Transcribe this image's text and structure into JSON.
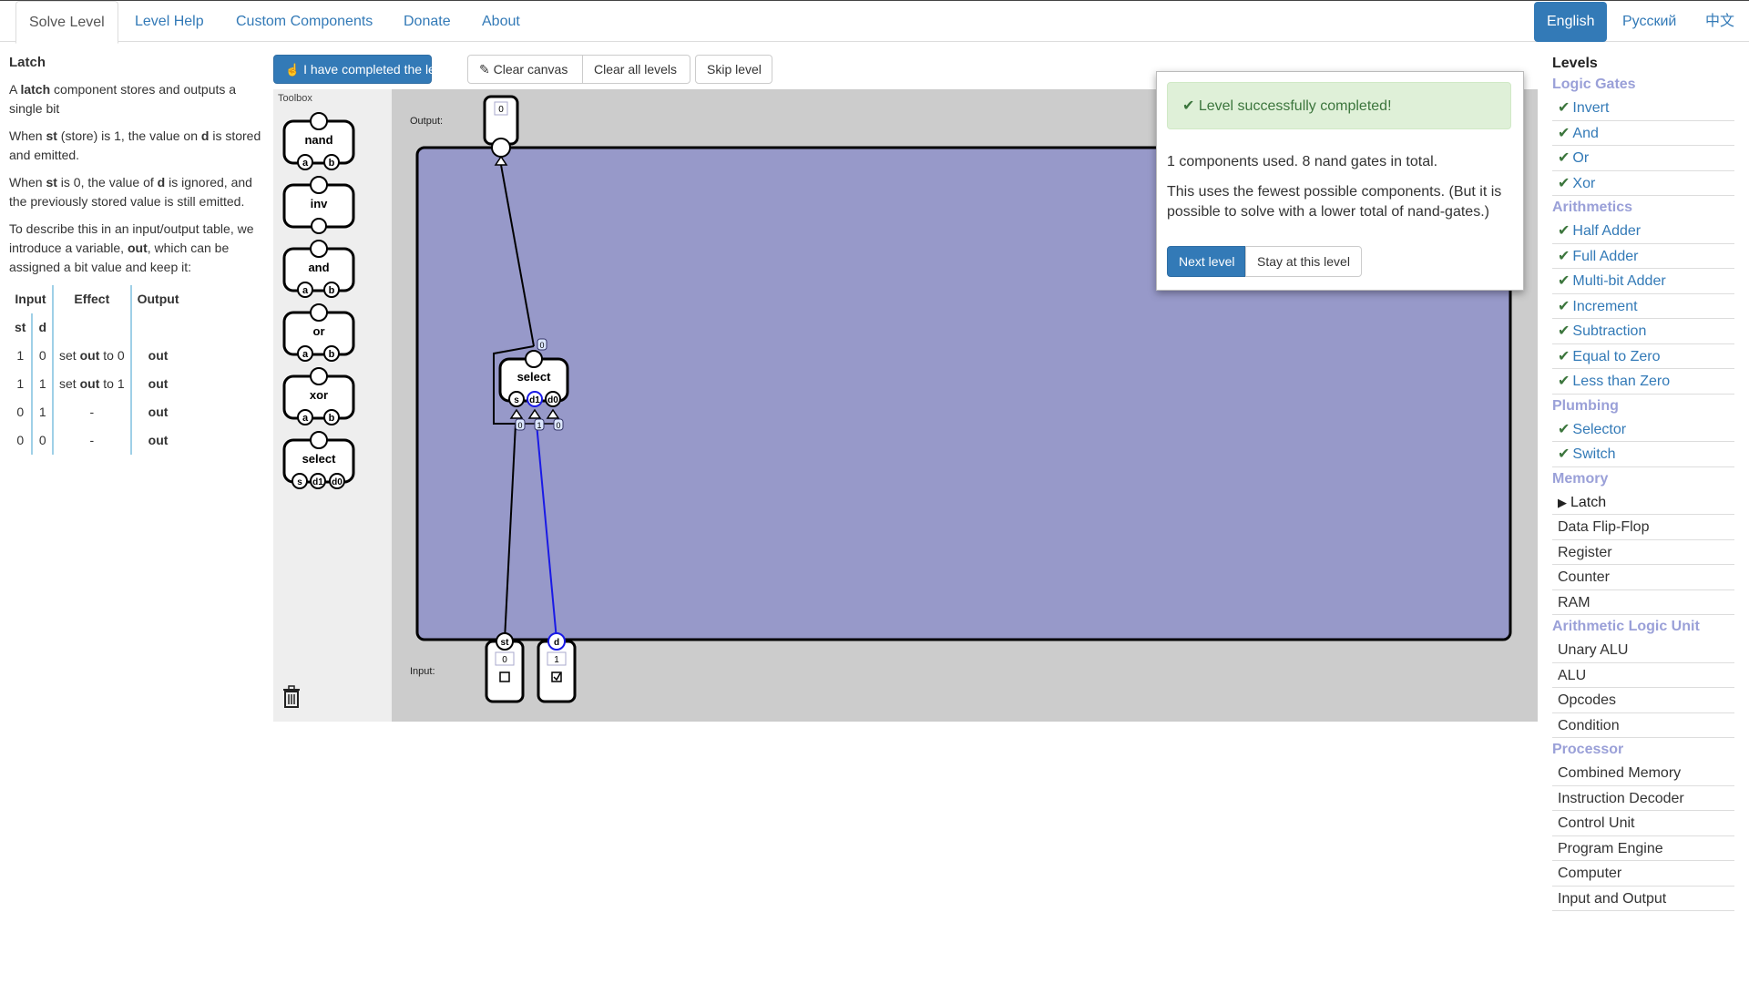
{
  "nav": {
    "tabs": [
      "Solve Level",
      "Level Help",
      "Custom Components",
      "Donate",
      "About"
    ],
    "languages": [
      "English",
      "Русский",
      "中文"
    ]
  },
  "level": {
    "title": "Latch",
    "p1_a": "A ",
    "p1_b": "latch",
    "p1_c": " component stores and outputs a single bit",
    "p2_a": "When ",
    "p2_b": "st",
    "p2_c": " (store) is 1, the value on ",
    "p2_d": "d",
    "p2_e": " is stored and emitted.",
    "p3_a": "When ",
    "p3_b": "st",
    "p3_c": " is 0, the value of ",
    "p3_d": "d",
    "p3_e": " is ignored, and the previously stored value is still emitted.",
    "p4_a": "To describe this in an input/output table, we introduce a variable, ",
    "p4_b": "out",
    "p4_c": ", which can be assigned a bit value and keep it:",
    "table": {
      "headers": [
        "Input",
        "Effect",
        "Output"
      ],
      "subheaders": [
        "st",
        "d"
      ],
      "rows": [
        {
          "st": "1",
          "d": "0",
          "effect_a": "set ",
          "effect_b": "out",
          "effect_c": " to 0",
          "output": "out"
        },
        {
          "st": "1",
          "d": "1",
          "effect_a": "set ",
          "effect_b": "out",
          "effect_c": " to 1",
          "output": "out"
        },
        {
          "st": "0",
          "d": "1",
          "effect_a": "",
          "effect_b": "-",
          "effect_c": "",
          "output": "out"
        },
        {
          "st": "0",
          "d": "0",
          "effect_a": "",
          "effect_b": "-",
          "effect_c": "",
          "output": "out"
        }
      ]
    }
  },
  "toolbar": {
    "complete": "I have completed the level",
    "clear_canvas": "Clear canvas",
    "clear_all": "Clear all levels",
    "skip": "Skip level"
  },
  "toolbox": {
    "label": "Toolbox",
    "components": [
      {
        "name": "nand",
        "pins": [
          "a",
          "b"
        ]
      },
      {
        "name": "inv",
        "pins": []
      },
      {
        "name": "and",
        "pins": [
          "a",
          "b"
        ]
      },
      {
        "name": "or",
        "pins": [
          "a",
          "b"
        ]
      },
      {
        "name": "xor",
        "pins": [
          "a",
          "b"
        ]
      },
      {
        "name": "select",
        "pins": [
          "s",
          "d1",
          "d0"
        ]
      }
    ]
  },
  "canvas": {
    "output_label": "Output:",
    "input_label": "Input:",
    "output_value": "0",
    "select_label": "select",
    "select_pins": [
      "s",
      "d1",
      "d0"
    ],
    "select_out_value": "0",
    "select_in_values": [
      "0",
      "1",
      "0"
    ],
    "inputs": [
      {
        "name": "st",
        "value": "0",
        "checked": false
      },
      {
        "name": "d",
        "value": "1",
        "checked": true
      }
    ]
  },
  "result": {
    "message": "Level successfully completed!",
    "stats": "1 components used. 8 nand gates in total.",
    "note": "This uses the fewest possible components. (But it is possible to solve with a lower total of nand-gates.)",
    "next": "Next level",
    "stay": "Stay at this level"
  },
  "levels": {
    "title": "Levels",
    "groups": [
      {
        "name": "Logic Gates",
        "items": [
          {
            "label": "Invert",
            "state": "done"
          },
          {
            "label": "And",
            "state": "done"
          },
          {
            "label": "Or",
            "state": "done"
          },
          {
            "label": "Xor",
            "state": "done"
          }
        ]
      },
      {
        "name": "Arithmetics",
        "items": [
          {
            "label": "Half Adder",
            "state": "done"
          },
          {
            "label": "Full Adder",
            "state": "done"
          },
          {
            "label": "Multi-bit Adder",
            "state": "done"
          },
          {
            "label": "Increment",
            "state": "done"
          },
          {
            "label": "Subtraction",
            "state": "done"
          },
          {
            "label": "Equal to Zero",
            "state": "done"
          },
          {
            "label": "Less than Zero",
            "state": "done"
          }
        ]
      },
      {
        "name": "Plumbing",
        "items": [
          {
            "label": "Selector",
            "state": "done"
          },
          {
            "label": "Switch",
            "state": "done"
          }
        ]
      },
      {
        "name": "Memory",
        "items": [
          {
            "label": "Latch",
            "state": "current"
          },
          {
            "label": "Data Flip-Flop",
            "state": "todo"
          },
          {
            "label": "Register",
            "state": "todo"
          },
          {
            "label": "Counter",
            "state": "todo"
          },
          {
            "label": "RAM",
            "state": "todo"
          }
        ]
      },
      {
        "name": "Arithmetic Logic Unit",
        "items": [
          {
            "label": "Unary ALU",
            "state": "todo"
          },
          {
            "label": "ALU",
            "state": "todo"
          },
          {
            "label": "Opcodes",
            "state": "todo"
          },
          {
            "label": "Condition",
            "state": "todo"
          }
        ]
      },
      {
        "name": "Processor",
        "items": [
          {
            "label": "Combined Memory",
            "state": "todo"
          },
          {
            "label": "Instruction Decoder",
            "state": "todo"
          },
          {
            "label": "Control Unit",
            "state": "todo"
          },
          {
            "label": "Program Engine",
            "state": "todo"
          },
          {
            "label": "Computer",
            "state": "todo"
          },
          {
            "label": "Input and Output",
            "state": "todo"
          }
        ]
      }
    ]
  }
}
